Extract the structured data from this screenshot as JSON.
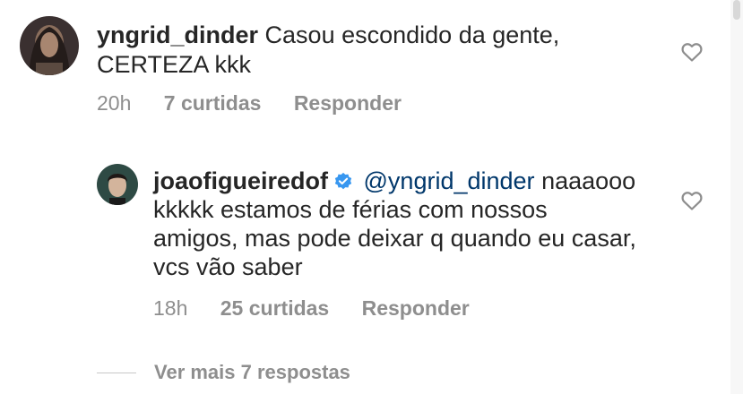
{
  "comment": {
    "username": "yngrid_dinder",
    "text": "Casou escondido da gente, CERTEZA kkk",
    "time": "20h",
    "likes": "7 curtidas",
    "reply_label": "Responder"
  },
  "reply": {
    "username": "joaofigueiredof",
    "mention": "@yngrid_dinder",
    "text": "naaaooo kkkkk estamos de férias com nossos amigos, mas pode deixar q quando eu casar, vcs vão saber",
    "time": "18h",
    "likes": "25 curtidas",
    "reply_label": "Responder"
  },
  "view_more": {
    "label": "Ver mais 7 respostas"
  },
  "colors": {
    "text": "#262626",
    "secondary": "#8e8e8e",
    "mention": "#00376b",
    "verified": "#3897f0"
  },
  "icons": [
    "heart-outline-icon",
    "verified-badge-icon"
  ]
}
